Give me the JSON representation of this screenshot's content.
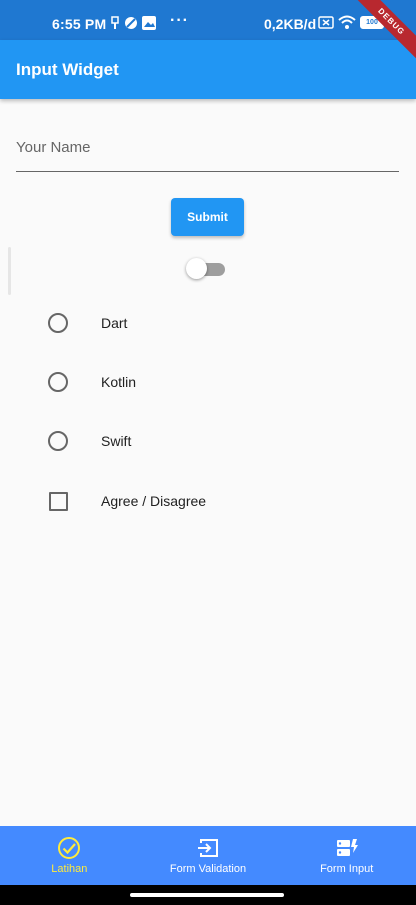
{
  "status_bar": {
    "time": "6:55 PM",
    "dots": "···",
    "network_speed": "0,2KB/d",
    "battery": "100"
  },
  "debug_banner": "DEBUG",
  "app_bar": {
    "title": "Input Widget"
  },
  "form": {
    "name_placeholder": "Your Name",
    "name_value": "",
    "submit_label": "Submit",
    "switch_on": false
  },
  "options": [
    {
      "type": "radio",
      "label": "Dart",
      "selected": false
    },
    {
      "type": "radio",
      "label": "Kotlin",
      "selected": false
    },
    {
      "type": "radio",
      "label": "Swift",
      "selected": false
    },
    {
      "type": "checkbox",
      "label": "Agree / Disagree",
      "checked": false
    }
  ],
  "bottom_nav": [
    {
      "label": "Latihan",
      "icon": "check-circle-icon",
      "active": true
    },
    {
      "label": "Form Validation",
      "icon": "input-icon",
      "active": false
    },
    {
      "label": "Form Input",
      "icon": "dynamic-form-icon",
      "active": false
    }
  ],
  "colors": {
    "status_bar": "#1f78d1",
    "primary": "#2196f3",
    "bottom_nav": "#448aff",
    "active_nav": "#ffeb3b",
    "debug": "#b8282f"
  }
}
